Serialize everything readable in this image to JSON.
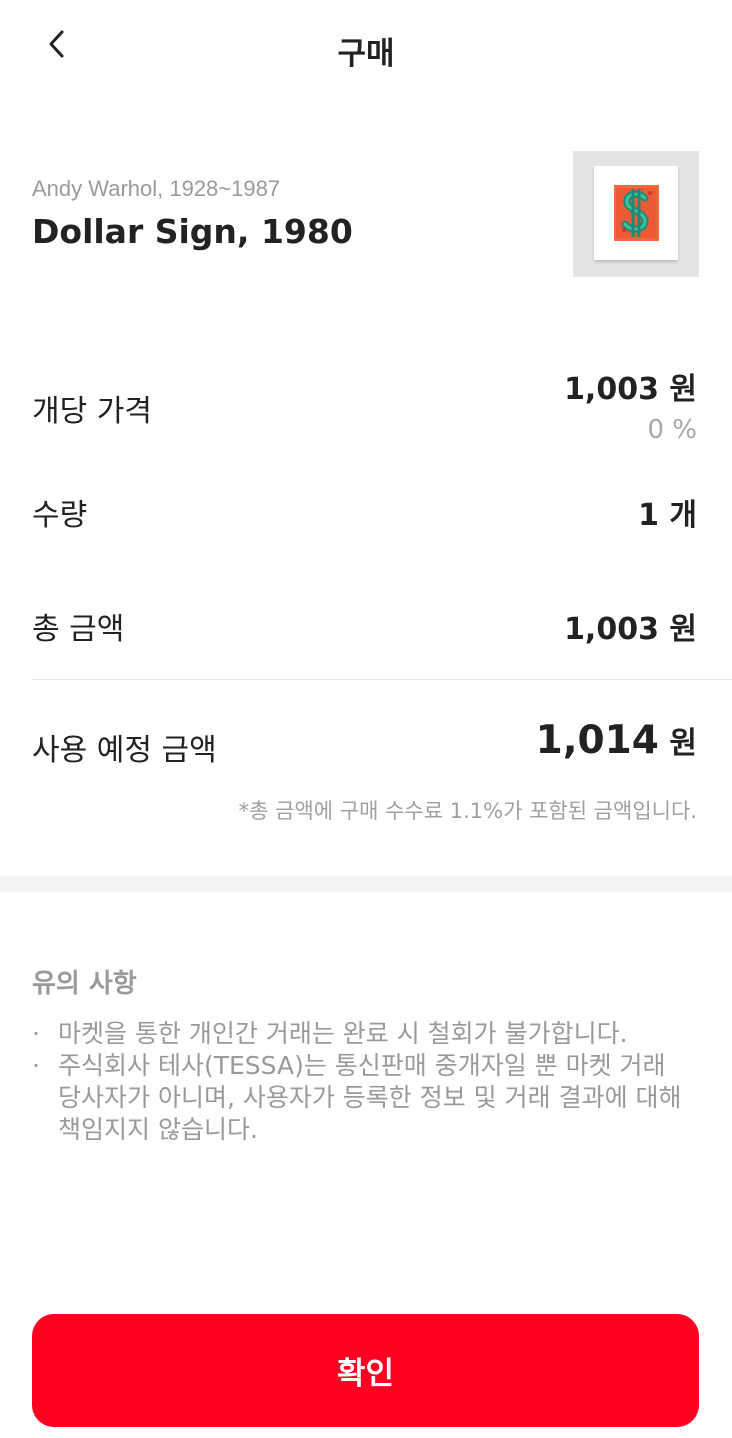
{
  "header": {
    "title": "구매",
    "back_icon": "chevron-left-icon"
  },
  "artwork": {
    "artist": "Andy Warhol, 1928~1987",
    "title": "Dollar Sign, 1980",
    "thumbnail_icon": "artwork-thumbnail"
  },
  "rows": {
    "unit_price": {
      "label": "개당 가격",
      "value": "1,003 원",
      "change": "0 %"
    },
    "quantity": {
      "label": "수량",
      "value": "1 개"
    },
    "total": {
      "label": "총 금액",
      "value": "1,003 원"
    },
    "expected": {
      "label": "사용 예정 금액",
      "amount": "1,014",
      "unit": "원"
    }
  },
  "fee_note": "*총 금액에 구매 수수료 1.1%가 포함된 금액입니다.",
  "notes": {
    "title": "유의 사항",
    "bullet": "·",
    "items": [
      "마켓을 통한 개인간 거래는 완료 시 철회가 불가합니다.",
      "주식회사 테사(TESSA)는 통신판매 중개자일 뿐 마켓 거래 당사자가 아니며, 사용자가 등록한 정보 및 거래 결과에 대해 책임지지 않습니다."
    ]
  },
  "confirm_button": {
    "label": "확인"
  },
  "colors": {
    "accent": "#ff0022",
    "muted_text": "#9a9a9a",
    "primary_text": "#222222"
  }
}
